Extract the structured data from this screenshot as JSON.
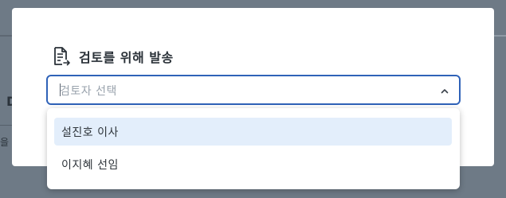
{
  "background": {
    "heading_fragment": "D",
    "text_fragment": "을"
  },
  "modal": {
    "title": "검토를 위해 발송",
    "title_icon": "document-send-icon"
  },
  "reviewer_select": {
    "placeholder": "검토자 선택",
    "toggle_icon": "chevron-up-icon",
    "options": [
      {
        "label": "설진호 이사",
        "highlighted": true
      },
      {
        "label": "이지혜 선임",
        "highlighted": false
      }
    ]
  },
  "colors": {
    "accent": "#2f62b8",
    "highlight": "#e3eefb"
  }
}
